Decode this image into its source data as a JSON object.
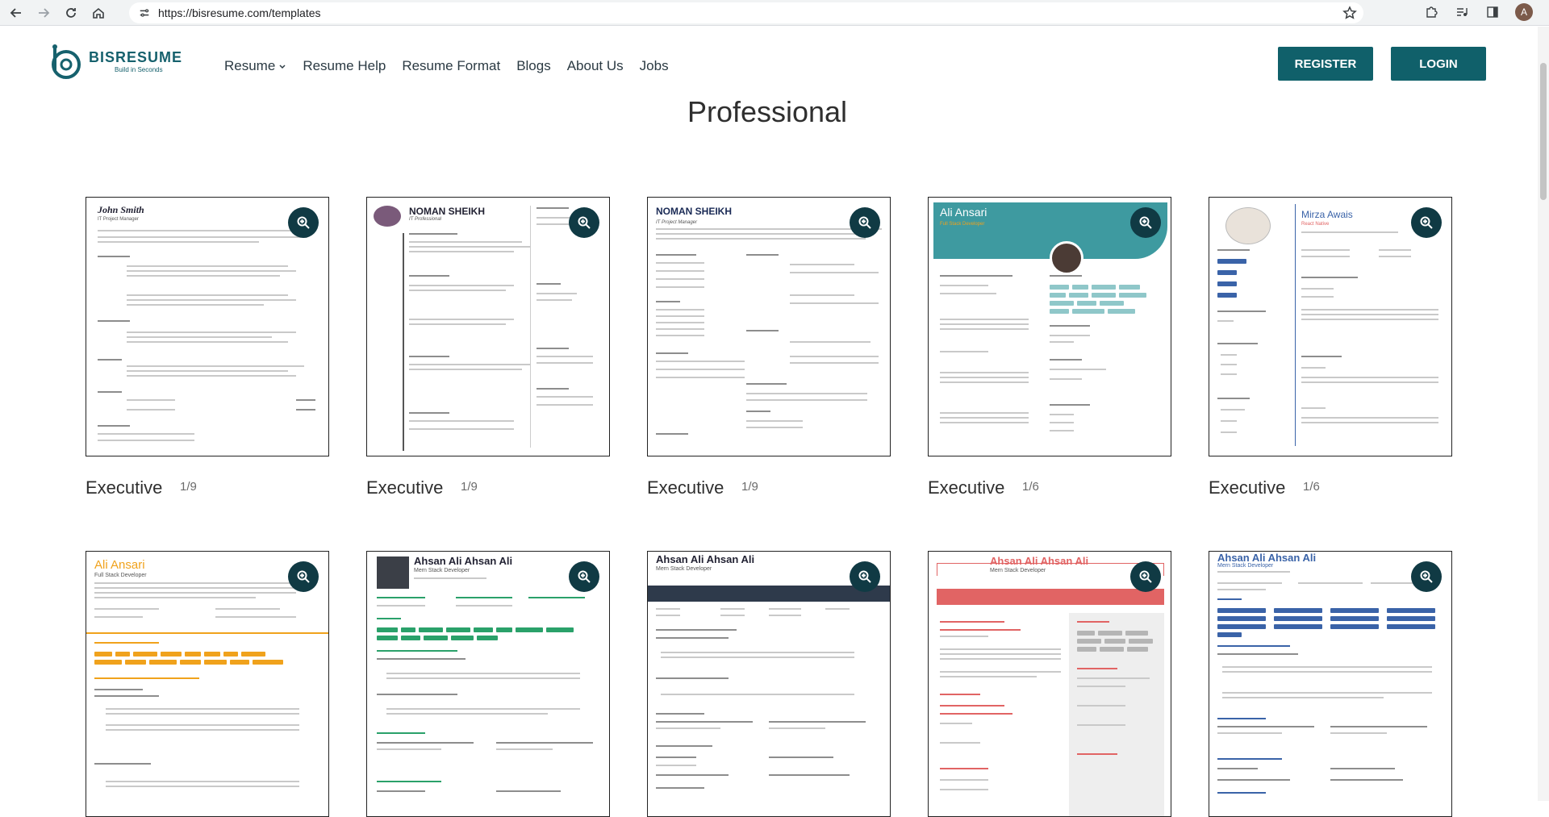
{
  "browser": {
    "url": "https://bisresume.com/templates",
    "avatar_letter": "A"
  },
  "header": {
    "logo_name": "BISRESUME",
    "logo_tagline": "Build in Seconds",
    "nav": [
      "Resume",
      "Resume Help",
      "Resume Format",
      "Blogs",
      "About Us",
      "Jobs"
    ],
    "register_label": "REGISTER",
    "login_label": "LOGIN"
  },
  "page_title": "Professional",
  "templates": [
    {
      "title": "Executive",
      "count": "1/9",
      "name": "John Smith",
      "role": "IT Project Manager"
    },
    {
      "title": "Executive",
      "count": "1/9",
      "name": "NOMAN    SHEIKH",
      "role": "IT Professional"
    },
    {
      "title": "Executive",
      "count": "1/9",
      "name": "NOMAN    SHEIKH",
      "role": "IT Project Manager"
    },
    {
      "title": "Executive",
      "count": "1/6",
      "name": "Ali Ansari",
      "role": "Full Stack Developer"
    },
    {
      "title": "Executive",
      "count": "1/6",
      "name": "Mirza Awais",
      "role": "React Native"
    },
    {
      "title": "",
      "count": "",
      "name": "Ali Ansari",
      "role": "Full Stack Developer"
    },
    {
      "title": "",
      "count": "",
      "name": "Ahsan Ali   Ahsan Ali",
      "role": "Mern Stack Developer"
    },
    {
      "title": "",
      "count": "",
      "name": "Ahsan Ali   Ahsan Ali",
      "role": "Mern Stack Developer"
    },
    {
      "title": "",
      "count": "",
      "name": "Ahsan Ali   Ahsan Ali",
      "role": "Mern Stack Developer"
    },
    {
      "title": "",
      "count": "",
      "name": "Ahsan Ali   Ahsan Ali",
      "role": "Mern Stack Developer"
    }
  ],
  "colors": {
    "brand": "#10606a",
    "zoom_button": "#103a44",
    "orange_accent": "#f0a21c",
    "green_accent": "#2aa16a",
    "red_accent": "#e16464",
    "blue_accent": "#3a63a8"
  },
  "icons": {
    "back": "back-arrow-icon",
    "forward": "forward-arrow-icon",
    "reload": "reload-icon",
    "home": "home-icon",
    "site_info": "tune-icon",
    "bookmark": "star-icon",
    "extensions": "puzzle-icon",
    "media": "media-control-icon",
    "sidebar": "side-panel-icon",
    "zoom": "zoom-in-icon"
  }
}
